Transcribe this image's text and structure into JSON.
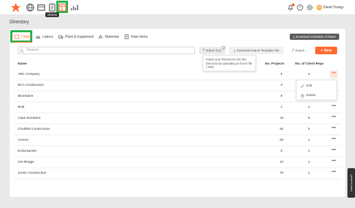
{
  "topbar": {
    "tooltip": "Sheets",
    "user_name": "David Young",
    "user_initials": "DY"
  },
  "page": {
    "title": "Directory"
  },
  "tabs": [
    {
      "label": "Clients",
      "icon": "clients-icon",
      "active": true
    },
    {
      "label": "Labour",
      "icon": "labour-icon"
    },
    {
      "label": "Plant & Equipment",
      "icon": "truck-icon"
    },
    {
      "label": "Materials",
      "icon": "materials-icon"
    },
    {
      "label": "Rate Items",
      "icon": "rate-items-icon"
    }
  ],
  "toolbar": {
    "download_schedule": "Download Schedule of Rates",
    "search_placeholder": "Search",
    "import_xls": "Import XLS",
    "download_template": "Download Import Template File",
    "export": "Export",
    "new": "+ New",
    "import_help": "Import your Resources into the Directory by uploading an Excel file (.xlsx)"
  },
  "table": {
    "headers": {
      "name": "Name",
      "projects": "No. Projects",
      "client_reps": "No. of Client Reps"
    },
    "rows": [
      {
        "name": "ABC Company",
        "projects": "5",
        "reps": "2"
      },
      {
        "name": "BCA Construction",
        "projects": "4",
        "reps": ""
      },
      {
        "name": "Blumhalze",
        "projects": "8",
        "reps": ""
      },
      {
        "name": "Built",
        "projects": "1",
        "reps": "2"
      },
      {
        "name": "Cape Dunstans",
        "projects": "43",
        "reps": "8"
      },
      {
        "name": "Chudlish Construction",
        "projects": "54",
        "reps": "5"
      },
      {
        "name": "Civmec",
        "projects": "65",
        "reps": "1"
      },
      {
        "name": "Endurapools",
        "projects": "0",
        "reps": "1"
      },
      {
        "name": "Joe Bloggs",
        "projects": "12",
        "reps": "1"
      },
      {
        "name": "Jurian Construction",
        "projects": "78",
        "reps": "1"
      }
    ]
  },
  "row_menu": {
    "edit": "Edit",
    "delete": "Delete"
  },
  "help": {
    "label": "Need a hand?"
  },
  "colors": {
    "accent": "#ff6a2f",
    "highlight": "#24b34b",
    "dark_button": "#5b5b5b"
  }
}
